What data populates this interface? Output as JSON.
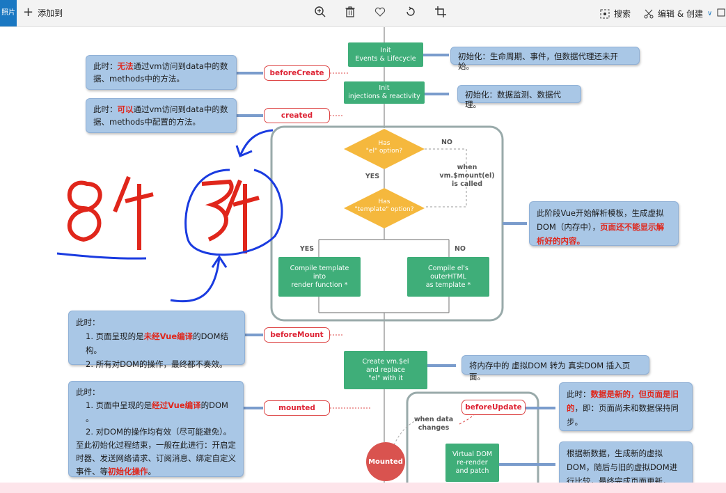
{
  "toolbar": {
    "badge": "照片",
    "add_to": "添加到",
    "search": "搜索",
    "edit_create": "编辑 & 创建"
  },
  "flow": {
    "init_events": "Init\nEvents & Lifecycle",
    "init_injections": "Init\ninjections & reactivity",
    "has_el": "Has\n\"el\" option?",
    "no1": "NO",
    "yes1": "YES",
    "when_mount": "when\nvm.$mount(el)\nis called",
    "has_template": "Has\n\"template\" option?",
    "yes2": "YES",
    "no2": "NO",
    "compile_template": "Compile template\ninto\nrender function *",
    "compile_outer": "Compile el's\nouterHTML\nas template *",
    "create_vm": "Create vm.$el\nand replace\n\"el\" with it",
    "when_data_changes": "when data\nchanges",
    "vdom_rerender": "Virtual DOM\nre-render\nand patch",
    "mounted_circle": "Mounted"
  },
  "hooks": {
    "beforeCreate": "beforeCreate",
    "created": "created",
    "beforeMount": "beforeMount",
    "mounted": "mounted",
    "beforeUpdate": "beforeUpdate"
  },
  "notes": {
    "bc_pre": "此时：",
    "bc_red": "无法",
    "bc_post": "通过vm访问到data中的数据、methods中的方法。",
    "cr_pre": "此时：",
    "cr_red": "可以",
    "cr_post": "通过vm访问到data中的数据、methods中配置的方法。",
    "init1": "初始化：生命周期、事件，但数据代理还未开始。",
    "init2": "初始化：数据监测、数据代理。",
    "parse_pre": "此阶段Vue开始解析模板，生成虚拟DOM（内存中），",
    "parse_red": "页面还不能显示解析好的内容。",
    "bm_title": "此时：",
    "bm_1_pre": "1. 页面呈现的是",
    "bm_1_red": "未经Vue编译",
    "bm_1_post": "的DOM结构。",
    "bm_2": "2. 所有对DOM的操作，最终都不奏效。",
    "insert": "将内存中的 虚拟DOM 转为 真实DOM 插入页面。",
    "m_title": "此时：",
    "m_1_pre": "1. 页面中呈现的是",
    "m_1_red": "经过Vue编译",
    "m_1_post": "的DOM 。",
    "m_2": "2. 对DOM的操作均有效（尽可能避免）。",
    "m_3_pre": "至此初始化过程结束，一般在此进行：开启定时器、发送网络请求、订阅消息、绑定自定义事件、等",
    "m_3_red": "初始化操作",
    "m_3_post": "。",
    "bu_pre": "此时：",
    "bu_red": "数据是新的，但页面是旧的",
    "bu_post": "，即：页面尚未和数据保持同步。",
    "rerender": "根据新数据，生成新的虚拟DOM，随后与旧的虚拟DOM进行比较，最终完成页面更新，即："
  },
  "colors": {
    "green": "#3fae79",
    "note_blue": "#a9c7e6",
    "hook_red": "#d44",
    "diamond": "#f5b83d",
    "annotation_red": "#e0261b",
    "annotation_blue": "#1a3be0"
  }
}
